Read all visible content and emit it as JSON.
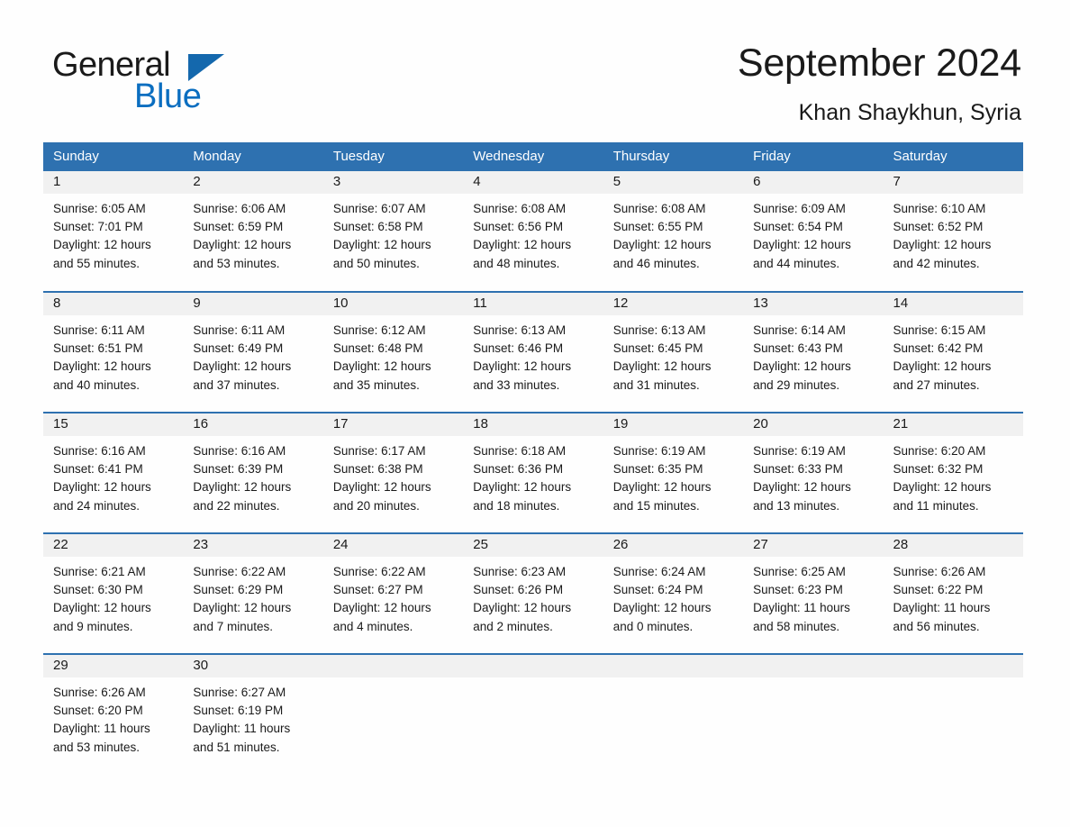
{
  "brand": {
    "word_one": "General",
    "word_two": "Blue",
    "triangle_icon": "blue-triangle-logo-icon",
    "colors": {
      "general": "#1a1a1a",
      "blue": "#0b6ec0",
      "triangle": "#1468ad"
    }
  },
  "header": {
    "title": "September 2024",
    "location": "Khan Shaykhun, Syria"
  },
  "theme": {
    "header_bg": "#2e71b0",
    "header_text": "#ffffff",
    "daynum_bg": "#f1f1f1",
    "row_border": "#2e71b0",
    "page_bg": "#fefefe",
    "body_text": "#1a1a1a"
  },
  "calendar": {
    "weekday_headers": [
      "Sunday",
      "Monday",
      "Tuesday",
      "Wednesday",
      "Thursday",
      "Friday",
      "Saturday"
    ],
    "labels": {
      "sunrise": "Sunrise:",
      "sunset": "Sunset:",
      "daylight": "Daylight:"
    },
    "weeks": [
      [
        {
          "day": "1",
          "sunrise": "Sunrise: 6:05 AM",
          "sunset": "Sunset: 7:01 PM",
          "daylight_line1": "Daylight: 12 hours",
          "daylight_line2": "and 55 minutes."
        },
        {
          "day": "2",
          "sunrise": "Sunrise: 6:06 AM",
          "sunset": "Sunset: 6:59 PM",
          "daylight_line1": "Daylight: 12 hours",
          "daylight_line2": "and 53 minutes."
        },
        {
          "day": "3",
          "sunrise": "Sunrise: 6:07 AM",
          "sunset": "Sunset: 6:58 PM",
          "daylight_line1": "Daylight: 12 hours",
          "daylight_line2": "and 50 minutes."
        },
        {
          "day": "4",
          "sunrise": "Sunrise: 6:08 AM",
          "sunset": "Sunset: 6:56 PM",
          "daylight_line1": "Daylight: 12 hours",
          "daylight_line2": "and 48 minutes."
        },
        {
          "day": "5",
          "sunrise": "Sunrise: 6:08 AM",
          "sunset": "Sunset: 6:55 PM",
          "daylight_line1": "Daylight: 12 hours",
          "daylight_line2": "and 46 minutes."
        },
        {
          "day": "6",
          "sunrise": "Sunrise: 6:09 AM",
          "sunset": "Sunset: 6:54 PM",
          "daylight_line1": "Daylight: 12 hours",
          "daylight_line2": "and 44 minutes."
        },
        {
          "day": "7",
          "sunrise": "Sunrise: 6:10 AM",
          "sunset": "Sunset: 6:52 PM",
          "daylight_line1": "Daylight: 12 hours",
          "daylight_line2": "and 42 minutes."
        }
      ],
      [
        {
          "day": "8",
          "sunrise": "Sunrise: 6:11 AM",
          "sunset": "Sunset: 6:51 PM",
          "daylight_line1": "Daylight: 12 hours",
          "daylight_line2": "and 40 minutes."
        },
        {
          "day": "9",
          "sunrise": "Sunrise: 6:11 AM",
          "sunset": "Sunset: 6:49 PM",
          "daylight_line1": "Daylight: 12 hours",
          "daylight_line2": "and 37 minutes."
        },
        {
          "day": "10",
          "sunrise": "Sunrise: 6:12 AM",
          "sunset": "Sunset: 6:48 PM",
          "daylight_line1": "Daylight: 12 hours",
          "daylight_line2": "and 35 minutes."
        },
        {
          "day": "11",
          "sunrise": "Sunrise: 6:13 AM",
          "sunset": "Sunset: 6:46 PM",
          "daylight_line1": "Daylight: 12 hours",
          "daylight_line2": "and 33 minutes."
        },
        {
          "day": "12",
          "sunrise": "Sunrise: 6:13 AM",
          "sunset": "Sunset: 6:45 PM",
          "daylight_line1": "Daylight: 12 hours",
          "daylight_line2": "and 31 minutes."
        },
        {
          "day": "13",
          "sunrise": "Sunrise: 6:14 AM",
          "sunset": "Sunset: 6:43 PM",
          "daylight_line1": "Daylight: 12 hours",
          "daylight_line2": "and 29 minutes."
        },
        {
          "day": "14",
          "sunrise": "Sunrise: 6:15 AM",
          "sunset": "Sunset: 6:42 PM",
          "daylight_line1": "Daylight: 12 hours",
          "daylight_line2": "and 27 minutes."
        }
      ],
      [
        {
          "day": "15",
          "sunrise": "Sunrise: 6:16 AM",
          "sunset": "Sunset: 6:41 PM",
          "daylight_line1": "Daylight: 12 hours",
          "daylight_line2": "and 24 minutes."
        },
        {
          "day": "16",
          "sunrise": "Sunrise: 6:16 AM",
          "sunset": "Sunset: 6:39 PM",
          "daylight_line1": "Daylight: 12 hours",
          "daylight_line2": "and 22 minutes."
        },
        {
          "day": "17",
          "sunrise": "Sunrise: 6:17 AM",
          "sunset": "Sunset: 6:38 PM",
          "daylight_line1": "Daylight: 12 hours",
          "daylight_line2": "and 20 minutes."
        },
        {
          "day": "18",
          "sunrise": "Sunrise: 6:18 AM",
          "sunset": "Sunset: 6:36 PM",
          "daylight_line1": "Daylight: 12 hours",
          "daylight_line2": "and 18 minutes."
        },
        {
          "day": "19",
          "sunrise": "Sunrise: 6:19 AM",
          "sunset": "Sunset: 6:35 PM",
          "daylight_line1": "Daylight: 12 hours",
          "daylight_line2": "and 15 minutes."
        },
        {
          "day": "20",
          "sunrise": "Sunrise: 6:19 AM",
          "sunset": "Sunset: 6:33 PM",
          "daylight_line1": "Daylight: 12 hours",
          "daylight_line2": "and 13 minutes."
        },
        {
          "day": "21",
          "sunrise": "Sunrise: 6:20 AM",
          "sunset": "Sunset: 6:32 PM",
          "daylight_line1": "Daylight: 12 hours",
          "daylight_line2": "and 11 minutes."
        }
      ],
      [
        {
          "day": "22",
          "sunrise": "Sunrise: 6:21 AM",
          "sunset": "Sunset: 6:30 PM",
          "daylight_line1": "Daylight: 12 hours",
          "daylight_line2": "and 9 minutes."
        },
        {
          "day": "23",
          "sunrise": "Sunrise: 6:22 AM",
          "sunset": "Sunset: 6:29 PM",
          "daylight_line1": "Daylight: 12 hours",
          "daylight_line2": "and 7 minutes."
        },
        {
          "day": "24",
          "sunrise": "Sunrise: 6:22 AM",
          "sunset": "Sunset: 6:27 PM",
          "daylight_line1": "Daylight: 12 hours",
          "daylight_line2": "and 4 minutes."
        },
        {
          "day": "25",
          "sunrise": "Sunrise: 6:23 AM",
          "sunset": "Sunset: 6:26 PM",
          "daylight_line1": "Daylight: 12 hours",
          "daylight_line2": "and 2 minutes."
        },
        {
          "day": "26",
          "sunrise": "Sunrise: 6:24 AM",
          "sunset": "Sunset: 6:24 PM",
          "daylight_line1": "Daylight: 12 hours",
          "daylight_line2": "and 0 minutes."
        },
        {
          "day": "27",
          "sunrise": "Sunrise: 6:25 AM",
          "sunset": "Sunset: 6:23 PM",
          "daylight_line1": "Daylight: 11 hours",
          "daylight_line2": "and 58 minutes."
        },
        {
          "day": "28",
          "sunrise": "Sunrise: 6:26 AM",
          "sunset": "Sunset: 6:22 PM",
          "daylight_line1": "Daylight: 11 hours",
          "daylight_line2": "and 56 minutes."
        }
      ],
      [
        {
          "day": "29",
          "sunrise": "Sunrise: 6:26 AM",
          "sunset": "Sunset: 6:20 PM",
          "daylight_line1": "Daylight: 11 hours",
          "daylight_line2": "and 53 minutes."
        },
        {
          "day": "30",
          "sunrise": "Sunrise: 6:27 AM",
          "sunset": "Sunset: 6:19 PM",
          "daylight_line1": "Daylight: 11 hours",
          "daylight_line2": "and 51 minutes."
        },
        {
          "day": "",
          "sunrise": "",
          "sunset": "",
          "daylight_line1": "",
          "daylight_line2": ""
        },
        {
          "day": "",
          "sunrise": "",
          "sunset": "",
          "daylight_line1": "",
          "daylight_line2": ""
        },
        {
          "day": "",
          "sunrise": "",
          "sunset": "",
          "daylight_line1": "",
          "daylight_line2": ""
        },
        {
          "day": "",
          "sunrise": "",
          "sunset": "",
          "daylight_line1": "",
          "daylight_line2": ""
        },
        {
          "day": "",
          "sunrise": "",
          "sunset": "",
          "daylight_line1": "",
          "daylight_line2": ""
        }
      ]
    ]
  }
}
